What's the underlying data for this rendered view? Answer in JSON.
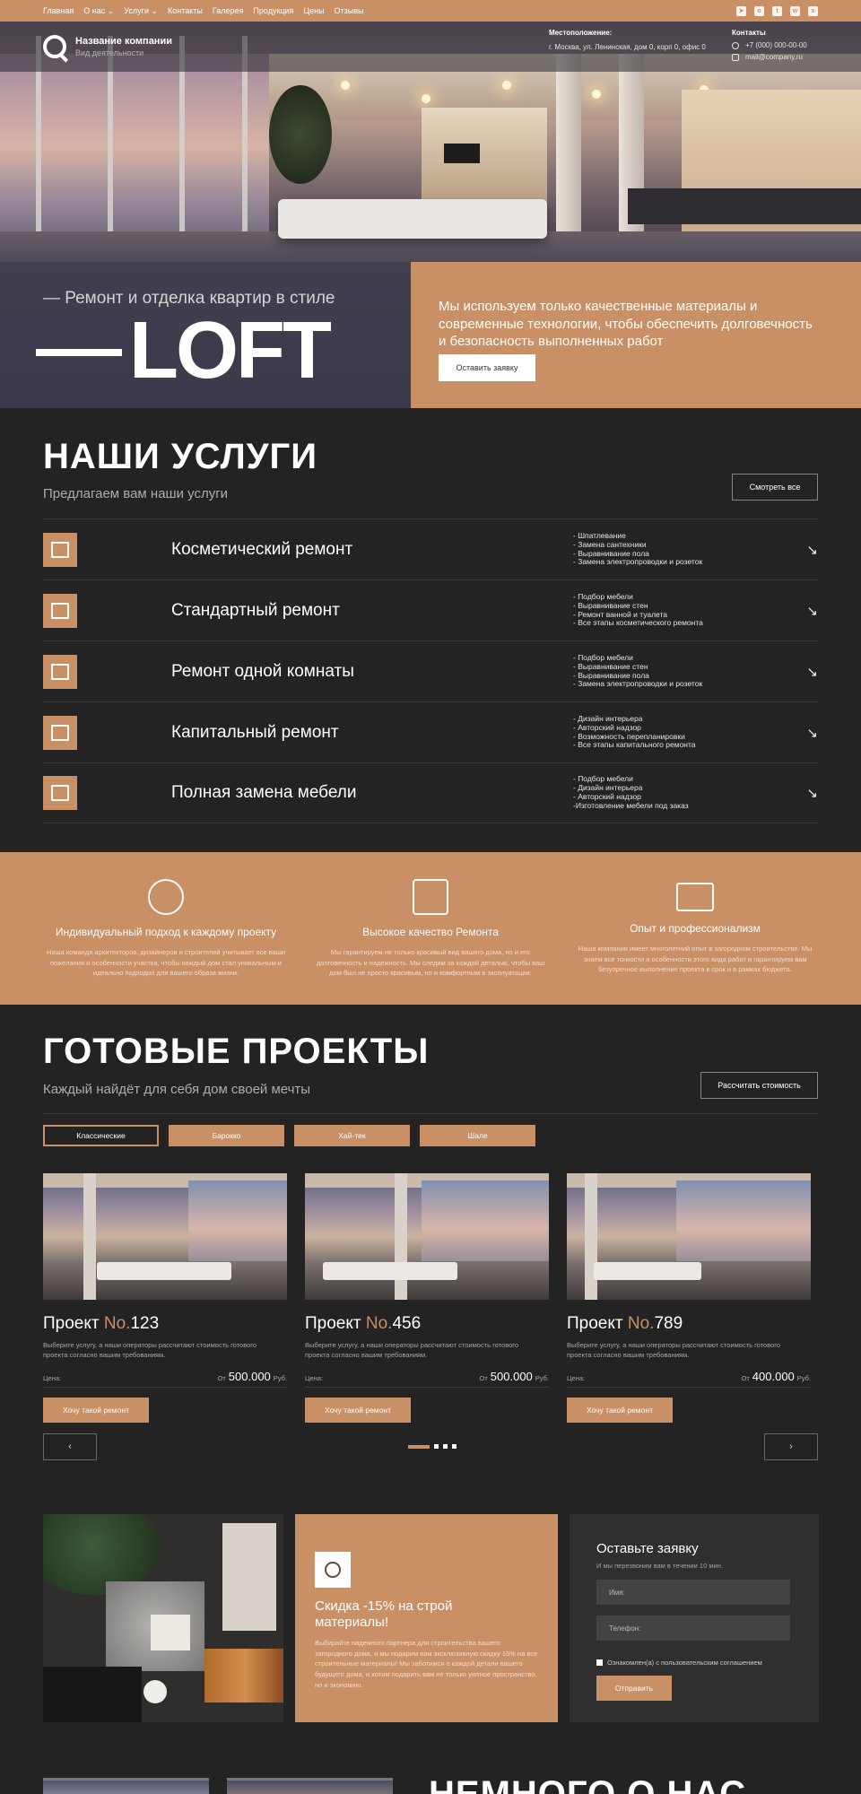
{
  "topnav": {
    "menu": [
      "Главная",
      "О нас ⌄",
      "Услуги ⌄",
      "Контакты",
      "Галерея",
      "Продукция",
      "Цены",
      "Отзывы"
    ],
    "social": [
      "telegram-icon",
      "ok-icon",
      "twitter-icon",
      "whatsapp-icon",
      "snapchat-icon"
    ]
  },
  "header": {
    "company_name": "Название компании",
    "company_activity": "Вид деятельности",
    "location_title": "Местоположение:",
    "location_value": "г. Москва, ул. Ленинская, дом 0, корп 0, офис 0",
    "contacts_title": "Контакты",
    "phone": "+7 (000) 000-00-00",
    "email": "mail@company.ru"
  },
  "hero": {
    "tagline": "— Ремонт и отделка квартир в стиле",
    "big_word": "LOFT",
    "description": "Мы используем только качественные материалы и современные технологии, чтобы обеспечить долговечность и безопасность выполненных работ",
    "cta": "Оставить заявку"
  },
  "services": {
    "title": "НАШИ УСЛУГИ",
    "subtitle": "Предлагаем вам наши услуги",
    "view_all": "Смотреть все",
    "items": [
      {
        "name": "Косметический ремонт",
        "bullets": "- Шпатлевание\n- Замена сантехники\n- Выравнивание пола\n- Замена электропроводки и розеток"
      },
      {
        "name": "Стандартный ремонт",
        "bullets": "- Подбор мебели\n- Выравнивание стен\n- Ремонт ванной и туалета\n- Все этапы косметического ремонта"
      },
      {
        "name": "Ремонт одной комнаты",
        "bullets": "- Подбор мебели\n- Выравнивание стен\n- Выравнивание пола\n- Замена электропроводки и розеток"
      },
      {
        "name": "Капитальный ремонт",
        "bullets": "- Дизайн интерьера\n- Авторский надзор\n- Возможность перепланировки\n- Все этапы капитального ремонта"
      },
      {
        "name": "Полная замена мебели",
        "bullets": "- Подбор мебели\n- Дизайн интерьера\n- Авторский надзор\n-Изготовление мебели под заказ"
      }
    ]
  },
  "features": [
    {
      "icon": "people-network-icon",
      "title": "Индивидуальный подход к каждому проекту",
      "text": "Наша команда архитекторов, дизайнеров и строителей учитывает все ваши пожелания и особенности участка, чтобы каждый дом стал уникальным и идеально подходил для вашего образа жизни."
    },
    {
      "icon": "house-icon",
      "title": "Высокое качество Ремонта",
      "text": "Мы гарантируем не только красивый вид вашего дома, но и его долговечность и надежность. Мы следим за каждой деталью, чтобы ваш дом был не просто красивым, но и комфортным в эксплуатации."
    },
    {
      "icon": "certificate-icon",
      "title": "Опыт и профессионализм",
      "text": "Наша компания имеет многолетний опыт в загородном строительстве. Мы знаем все тонкости и особенности этого вида работ и гарантируем вам безупречное выполнение проекта в срок и в рамках бюджета."
    }
  ],
  "projects": {
    "title": "ГОТОВЫЕ ПРОЕКТЫ",
    "subtitle": "Каждый найдёт для  себя дом своей мечты",
    "calc": "Рассчитать стоимость",
    "tabs": [
      "Классические",
      "Барокко",
      "Хай-тек",
      "Шале"
    ],
    "cards": [
      {
        "title_prefix": "Проект ",
        "no": "No.",
        "num": "123",
        "desc": "Выберите услугу, а наши операторы рассчитают стоимость готового проекта согласно вашим требованиям.",
        "price_label": "Цена:",
        "from": "От",
        "price": "500.000",
        "currency": "Руб.",
        "button": "Хочу такой ремонт"
      },
      {
        "title_prefix": "Проект ",
        "no": "No.",
        "num": "456",
        "desc": "Выберите услугу, а наши операторы рассчитают стоимость готового проекта согласно вашим требованиям.",
        "price_label": "Цена:",
        "from": "От",
        "price": "500.000",
        "currency": "Руб.",
        "button": "Хочу такой ремонт"
      },
      {
        "title_prefix": "Проект ",
        "no": "No.",
        "num": "789",
        "desc": "Выберите услугу, а наши операторы рассчитают стоимость готового проекта согласно вашим требованиям.",
        "price_label": "Цена:",
        "from": "От",
        "price": "400.000",
        "currency": "Руб.",
        "button": "Хочу такой ремонт"
      }
    ],
    "prev": "‹",
    "next": "›"
  },
  "promo": {
    "title": "Скидка -15% на строй материалы!",
    "text": "Выбирайте надежного партнера для строительства вашего загородного дома, и мы подарим вам эксклюзивную скидку 15% на все строительные материалы! Мы заботимся о каждой детали вашего будущего дома, и хотим подарить вам не только уютное пространство, но и экономию."
  },
  "form": {
    "title": "Оставьте заявку",
    "subtitle": "И мы перезвоним вам в течении 10 мин.",
    "name_placeholder": "Имя:",
    "phone_placeholder": "Телефон:",
    "agree": "Ознакомлен(а) с пользовательским соглашением",
    "submit": "Отправить"
  },
  "about": {
    "title": "НЕМНОГО О НАС"
  },
  "colors": {
    "accent": "#c98f65",
    "background": "#232323"
  }
}
